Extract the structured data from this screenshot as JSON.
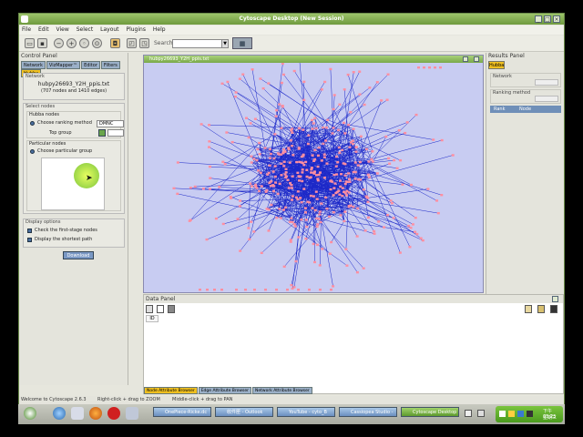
{
  "window": {
    "title": "Cytoscape Desktop (New Session)"
  },
  "menu": [
    "File",
    "Edit",
    "View",
    "Select",
    "Layout",
    "Plugins",
    "Help"
  ],
  "toolbar": {
    "search_label": "Search:"
  },
  "control_panel": {
    "title": "Control Panel",
    "tabs": [
      "Network",
      "VizMapper™",
      "Editor",
      "Filters",
      "Hubba"
    ],
    "network_section": "Network",
    "network_name": "hubpy26693_Y2H_ppis.txt",
    "network_stats": "(707 nodes and 1410 edges)",
    "select_nodes": "Select nodes",
    "hubs_nodes": "Hubba nodes",
    "choose_ranking": "Choose ranking method",
    "ranking_value": "DMNC",
    "top_group": "Top group",
    "particular_nodes": "Particular nodes",
    "choose_particular": "Choose particular group",
    "display_options": "Display options",
    "opt_first_stage": "Check the first-stage nodes",
    "opt_shortest_path": "Display the shortest path",
    "download_label": "Download"
  },
  "network_view": {
    "title": "hubpy26693_Y2H_ppis.txt"
  },
  "results_panel": {
    "title": "Results Panel",
    "tab": "Hubba",
    "network_label": "Network",
    "ranking_label": "Ranking method",
    "col_rank": "Rank",
    "col_node": "Node"
  },
  "data_panel": {
    "title": "Data Panel",
    "id_label": "ID",
    "tabs": [
      "Node Attribute Browser",
      "Edge Attribute Browser",
      "Network Attribute Browser"
    ]
  },
  "status": {
    "welcome": "Welcome to Cytoscape 2.6.3",
    "zoom_hint": "Right-click + drag to ZOOM",
    "pan_hint": "Middle-click + drag to PAN"
  },
  "taskbar": {
    "tasks": [
      "OnePiece-Ricke.dc",
      "收件匣 - Outlook",
      "YouTube - cyto_B",
      "Cassiopea Studio -",
      "Cytoscape Desktop"
    ],
    "time": "下午 03:25",
    "day": "星期三"
  },
  "colors": {
    "node": "#ff8fa0",
    "edge": "#1c28c8",
    "canvas": "#c8ccf2"
  }
}
